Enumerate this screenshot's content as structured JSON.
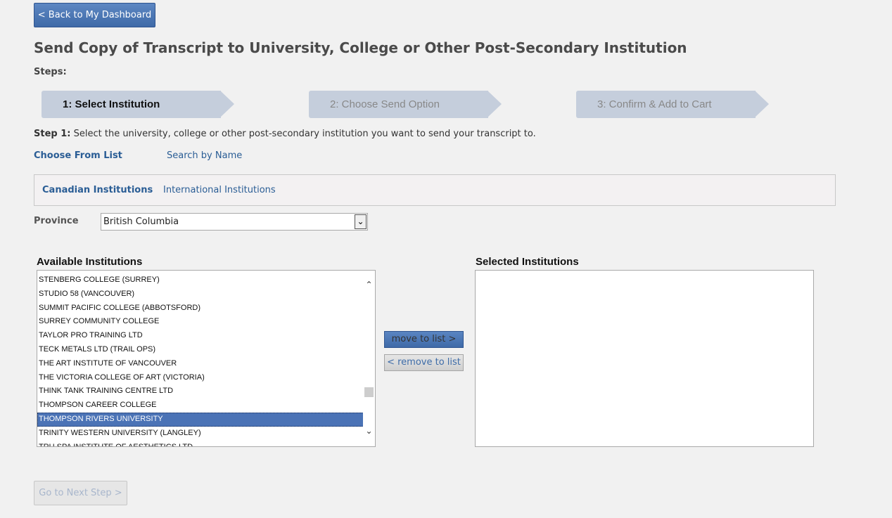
{
  "header": {
    "back_label": "< Back to My Dashboard",
    "title": "Send Copy of Transcript to University, College or Other Post-Secondary Institution",
    "steps_label": "Steps:"
  },
  "steps": [
    {
      "label": "1: Select Institution",
      "active": true
    },
    {
      "label": "2: Choose Send Option",
      "active": false
    },
    {
      "label": "3: Confirm & Add to Cart",
      "active": false
    }
  ],
  "instructions": {
    "step_prefix": "Step 1:",
    "text": " Select the university, college or other post-secondary institution you want to send your transcript to."
  },
  "method_tabs": {
    "choose_from_list": "Choose From List",
    "search_by_name": "Search by Name"
  },
  "region_tabs": {
    "canadian": "Canadian Institutions",
    "international": "International Institutions"
  },
  "province": {
    "label": "Province",
    "value": "British Columbia"
  },
  "available": {
    "heading": "Available Institutions",
    "items": [
      "STENBERG COLLEGE (SURREY)",
      "STUDIO 58 (VANCOUVER)",
      "SUMMIT PACIFIC COLLEGE (ABBOTSFORD)",
      "SURREY COMMUNITY COLLEGE",
      "TAYLOR PRO TRAINING LTD",
      "TECK METALS LTD (TRAIL OPS)",
      "THE ART INSTITUTE OF VANCOUVER",
      "THE VICTORIA COLLEGE OF ART (VICTORIA)",
      "THINK TANK TRAINING CENTRE LTD",
      "THOMPSON CAREER COLLEGE",
      "THOMPSON RIVERS UNIVERSITY",
      "TRINITY WESTERN UNIVERSITY (LANGLEY)",
      "TRU SPA INSTITUTE OF AESTHETICS LTD"
    ],
    "selected_index": 10
  },
  "transfer": {
    "move_label": "move to list >",
    "remove_label": "< remove to list"
  },
  "selected": {
    "heading": "Selected Institutions"
  },
  "footer": {
    "next_label": "Go to Next Step >"
  }
}
